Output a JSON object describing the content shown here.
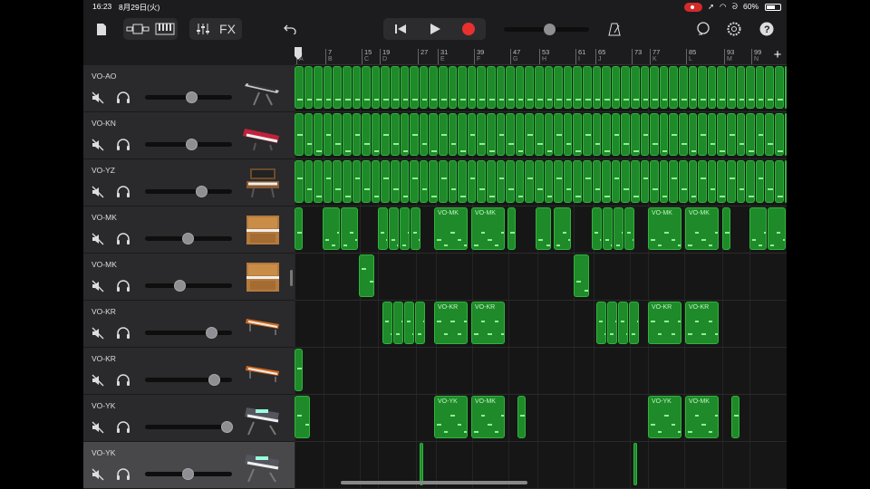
{
  "status": {
    "time": "16:23",
    "date": "8月29日(火)",
    "battery": "60%"
  },
  "toolbar": {
    "fx_label": "FX"
  },
  "ruler": {
    "bars": [
      "1",
      "7",
      "15",
      "19",
      "27",
      "31",
      "39",
      "47",
      "53",
      "61",
      "65",
      "73",
      "77",
      "85",
      "93",
      "99"
    ],
    "sections": [
      "A",
      "B",
      "C",
      "D",
      "",
      "E",
      "F",
      "G",
      "H",
      "I",
      "J",
      "",
      "K",
      "L",
      "M",
      "N"
    ]
  },
  "tracks": [
    {
      "name": "VO-AO",
      "volume": 0.5,
      "instrument": "stage-keyboard",
      "selected": false
    },
    {
      "name": "VO-KN",
      "volume": 0.5,
      "instrument": "red-synth",
      "selected": false
    },
    {
      "name": "VO-YZ",
      "volume": 0.62,
      "instrument": "analog-synth",
      "selected": false
    },
    {
      "name": "VO-MK",
      "volume": 0.46,
      "instrument": "upright-piano",
      "selected": false
    },
    {
      "name": "VO-MK",
      "volume": 0.36,
      "instrument": "upright-piano",
      "selected": false
    },
    {
      "name": "VO-KR",
      "volume": 0.74,
      "instrument": "electric-piano",
      "selected": false
    },
    {
      "name": "VO-KR",
      "volume": 0.78,
      "instrument": "electric-piano",
      "selected": false
    },
    {
      "name": "VO-YK",
      "volume": 0.93,
      "instrument": "workstation-keyboard",
      "selected": false
    },
    {
      "name": "VO-YK",
      "volume": 0.46,
      "instrument": "workstation-keyboard",
      "selected": true
    }
  ],
  "regions": [
    [],
    [],
    [],
    [
      "VO-MK",
      "VO-MK",
      "VO-MK",
      "VO-MK"
    ],
    [],
    [
      "VO-KR",
      "VO-KR",
      "VO-KR",
      "VO-KR"
    ],
    [],
    [
      "VO-YK",
      "VO-MK",
      "VO-YK",
      "VO-MK"
    ],
    []
  ],
  "colors": {
    "region": "#1f8a2a",
    "region_border": "#2fb43c",
    "record": "#e8312f",
    "note": "#8ff08f"
  }
}
